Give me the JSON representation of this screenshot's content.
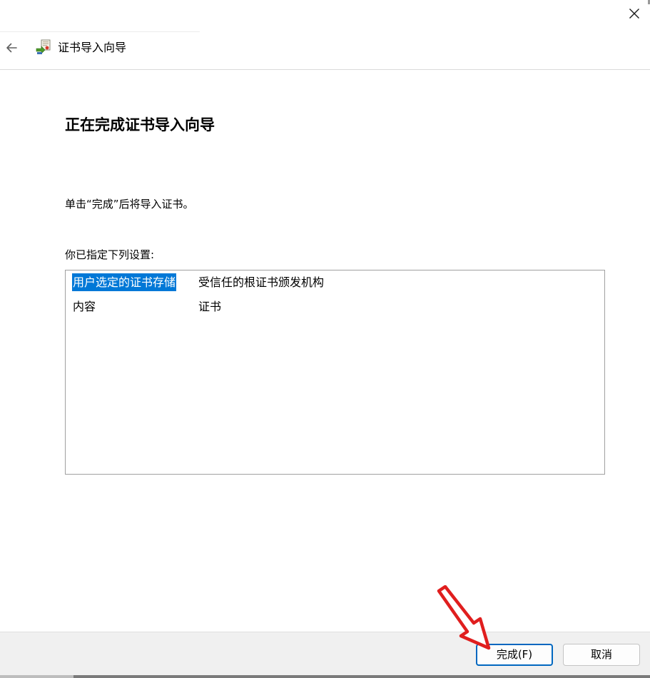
{
  "header": {
    "title": "证书导入向导"
  },
  "main": {
    "page_title": "正在完成证书导入向导",
    "instruction": "单击“完成”后将导入证书。",
    "settings_label": "你已指定下列设置:",
    "settings": [
      {
        "key": "用户选定的证书存储",
        "value": "受信任的根证书颁发机构",
        "selected": true
      },
      {
        "key": "内容",
        "value": "证书",
        "selected": false
      }
    ]
  },
  "footer": {
    "finish_label": "完成(F)",
    "cancel_label": "取消"
  },
  "icons": {
    "close": "close-icon",
    "back": "back-arrow-icon",
    "wizard": "certificate-wizard-icon",
    "annotation": "red-arrow-annotation"
  },
  "colors": {
    "selection": "#0078d7",
    "primary_border": "#0067c0",
    "annotation": "#e01e1e"
  }
}
